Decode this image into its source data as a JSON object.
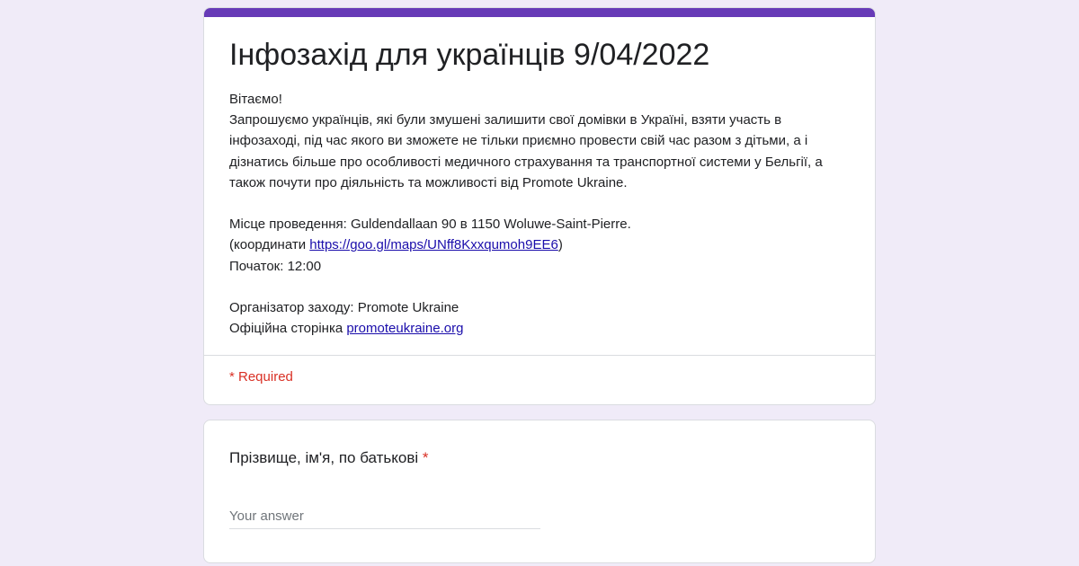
{
  "form": {
    "title": "Інфозахід для українців 9/04/2022",
    "description": {
      "greeting": "Вітаємо!",
      "intro": "Запрошуємо українців, які були змушені залишити свої домівки в Україні, взяти участь в інфозаході, під час якого ви зможете не тільки приємно провести свій час разом з дітьми, а і дізнатись більше про особливості медичного страхування та транспортної системи у Бельгії, а також почути про діяльність та можливості від Promote Ukraine.",
      "venue": "Місце проведення: Guldendallaan 90 в 1150 Woluwe-Saint-Pierre.",
      "coords_prefix": "(координати ",
      "coords_link": "https://goo.gl/maps/UNff8Kxxqumoh9EE6",
      "coords_suffix": ")",
      "start": "Початок: 12:00",
      "organizer": "Організатор заходу: Promote Ukraine",
      "page_prefix": "Офіційна сторінка ",
      "page_link": "promoteukraine.org"
    },
    "required_note": "* Required"
  },
  "question": {
    "label": "Прізвище, ім'я, по батькові",
    "required_star": "*",
    "placeholder": "Your answer",
    "value": ""
  },
  "colors": {
    "accent": "#673ab7",
    "background": "#f0ebf8",
    "required": "#d93025",
    "link": "#1a0dab"
  }
}
